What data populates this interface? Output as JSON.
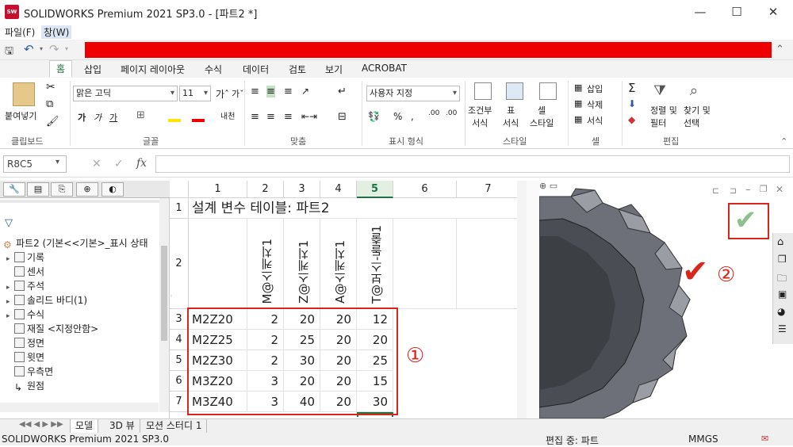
{
  "window": {
    "title": "SOLIDWORKS Premium 2021 SP3.0 - [파트2 *]",
    "controls": {
      "minimize": "—",
      "maximize": "☐",
      "close": "✕"
    }
  },
  "menubar": {
    "items": [
      "파일(F)",
      "창(W)"
    ]
  },
  "ribbon_tabs": [
    "홈",
    "삽입",
    "페이지 레이아웃",
    "수식",
    "데이터",
    "검토",
    "보기",
    "ACROBAT"
  ],
  "ribbon": {
    "clipboard": {
      "paste": "붙여넣기",
      "label": "클립보드"
    },
    "font": {
      "name": "맑은 고딕",
      "size": "11",
      "bold": "가",
      "italic": "가",
      "underline": "가",
      "label": "글꼴"
    },
    "align": {
      "label": "맞춤"
    },
    "number": {
      "format": "사용자 지정",
      "label": "표시 형식"
    },
    "style": {
      "conditional": "조건부\n서식",
      "table": "표\n서식",
      "cell": "셀\n스타일",
      "label": "스타일"
    },
    "cells": {
      "insert": "삽입",
      "delete": "삭제",
      "format": "서식",
      "label": "셀"
    },
    "edit": {
      "sort": "정렬 및\n필터",
      "find": "찾기 및\n선택",
      "label": "편집"
    }
  },
  "formula_bar": {
    "name_box": "R8C5",
    "value": ""
  },
  "feature_tree": {
    "root": "파트2  (기본<<기본>_표시 상태",
    "items": [
      "기록",
      "센서",
      "주석",
      "솔리드 바디(1)",
      "수식",
      "재질 <지정안함>",
      "정면",
      "윗면",
      "우측면",
      "원점"
    ]
  },
  "sheet": {
    "col_headers": [
      "1",
      "2",
      "3",
      "4",
      "5",
      "6",
      "7"
    ],
    "row_headers": [
      "1",
      "2",
      "3",
      "4",
      "5",
      "6",
      "7"
    ],
    "title": "설계 변수 테이블: 파트2",
    "params": [
      "M@스케치1",
      "Z@스케치1",
      "A@스케치1",
      "T@보스-돌출1"
    ],
    "rows": [
      {
        "name": "M2Z20",
        "M": "2",
        "Z": "20",
        "A": "20",
        "T": "12"
      },
      {
        "name": "M2Z25",
        "M": "2",
        "Z": "25",
        "A": "20",
        "T": "20"
      },
      {
        "name": "M2Z30",
        "M": "2",
        "Z": "30",
        "A": "20",
        "T": "25"
      },
      {
        "name": "M3Z20",
        "M": "3",
        "Z": "20",
        "A": "20",
        "T": "15"
      },
      {
        "name": "M3Z40",
        "M": "3",
        "Z": "40",
        "A": "20",
        "T": "30"
      }
    ],
    "callout1": "①",
    "callout2": "②"
  },
  "sheet_tabs": [
    "모델",
    "3D 뷰",
    "모션 스터디 1"
  ],
  "status": {
    "app": "SOLIDWORKS Premium 2021 SP3.0",
    "mode": "편집 중: 파트",
    "units": "MMGS"
  }
}
